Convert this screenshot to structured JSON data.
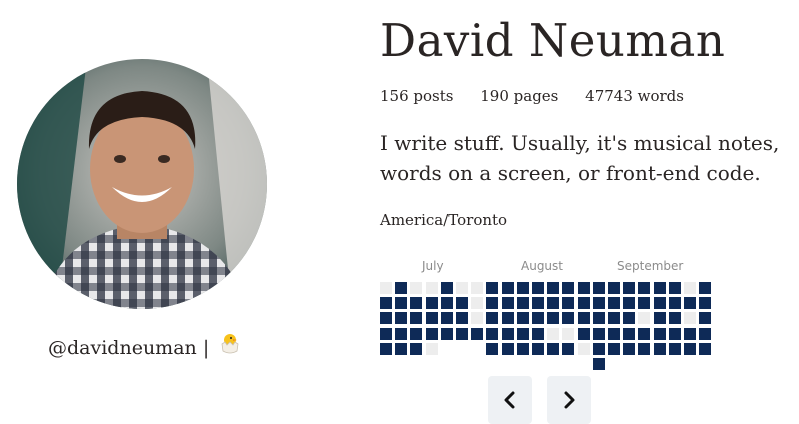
{
  "profile": {
    "name": "David Neuman",
    "handle": "@davidneuman",
    "separator": "|",
    "emoji_icon": "hatching-chick-icon"
  },
  "stats": {
    "posts": "156 posts",
    "pages": "190 pages",
    "words": "47743 words"
  },
  "bio": "I write stuff. Usually, it's musical notes, words on a screen, or front-end code.",
  "timezone": "America/Toronto",
  "calendar": {
    "months": [
      "July",
      "August",
      "September"
    ],
    "columns": [
      [
        0,
        1,
        1,
        1,
        1
      ],
      [
        1,
        1,
        1,
        1,
        1
      ],
      [
        0,
        1,
        1,
        1,
        1
      ],
      [
        0,
        1,
        1,
        1,
        0
      ],
      [
        1,
        1,
        1,
        1
      ],
      [
        0,
        1,
        1,
        1
      ],
      [
        0,
        0,
        0,
        1
      ],
      [
        1,
        1,
        1,
        1,
        1
      ],
      [
        1,
        1,
        1,
        1,
        1
      ],
      [
        1,
        1,
        1,
        1,
        1
      ],
      [
        1,
        1,
        1,
        1,
        1
      ],
      [
        1,
        1,
        1,
        0,
        1
      ],
      [
        1,
        1,
        1,
        0,
        1
      ],
      [
        1,
        1,
        1,
        1,
        0
      ],
      [
        1,
        1,
        1,
        1,
        1,
        1
      ],
      [
        1,
        1,
        1,
        1,
        1
      ],
      [
        1,
        1,
        1,
        1,
        1
      ],
      [
        1,
        1,
        0,
        1,
        1
      ],
      [
        1,
        1,
        1,
        1,
        1
      ],
      [
        1,
        1,
        1,
        1,
        1
      ],
      [
        0,
        1,
        0,
        1,
        1
      ],
      [
        1,
        1,
        1,
        1,
        1
      ]
    ],
    "accent": "#0e2a57",
    "empty": "#ededed"
  },
  "nav": {
    "prev_icon": "chevron-left-icon",
    "next_icon": "chevron-right-icon"
  }
}
